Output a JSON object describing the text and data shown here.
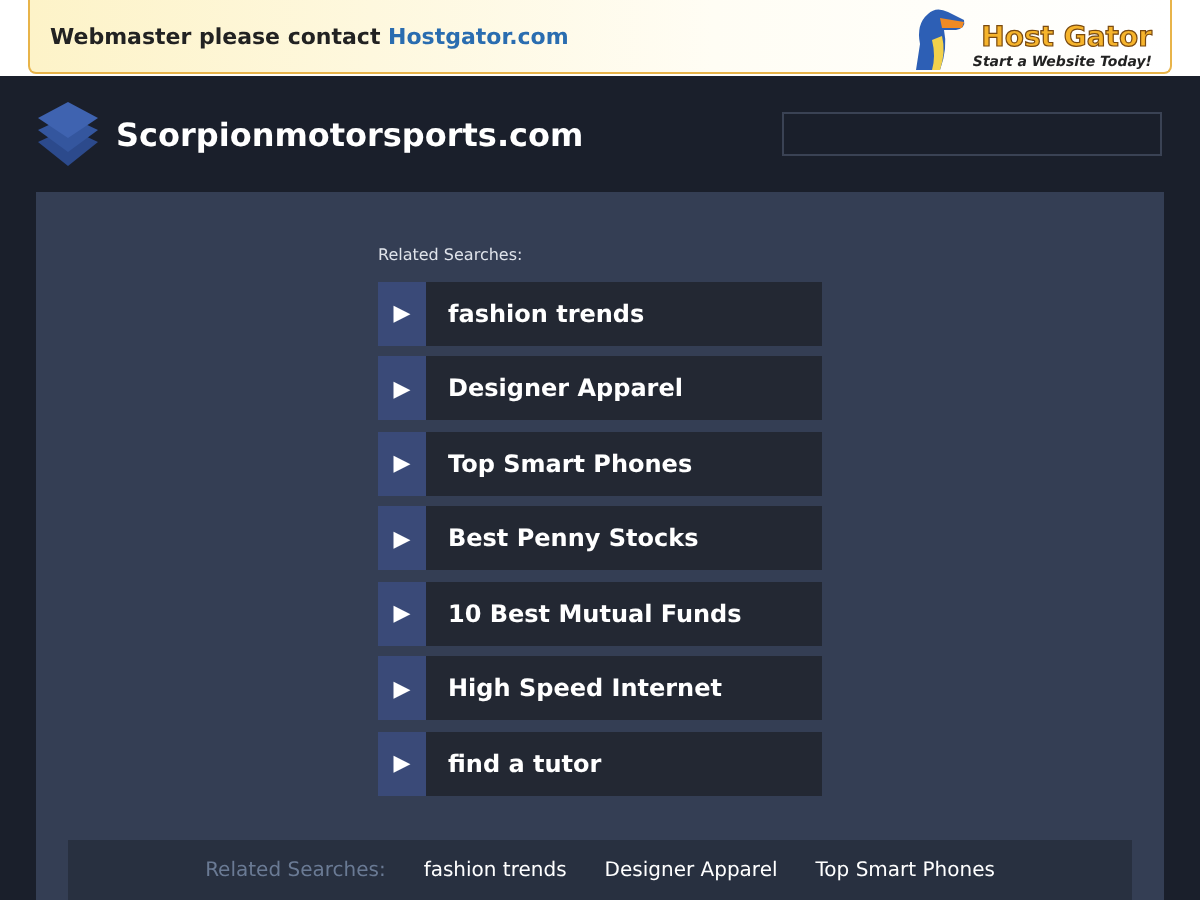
{
  "banner": {
    "message": "Webmaster please contact",
    "link": "Hostgator.com",
    "logo_name": "Host Gator",
    "logo_tagline": "Start a Website Today!"
  },
  "header": {
    "site_name": "Scorpionmotorsports.com"
  },
  "related": {
    "label": "Related Searches:",
    "items": [
      {
        "icon": "▶",
        "text": "fashion trends"
      },
      {
        "icon": "▶",
        "text": "Designer Apparel"
      },
      {
        "icon": "▶",
        "text": "Top Smart Phones"
      },
      {
        "icon": "▶",
        "text": "Best Penny Stocks"
      },
      {
        "icon": "▶",
        "text": "10 Best Mutual Funds"
      },
      {
        "icon": "▶",
        "text": "High Speed Internet"
      },
      {
        "icon": "▶",
        "text": "find a tutor"
      }
    ]
  },
  "footer": {
    "label": "Related Searches:",
    "links": [
      "fashion trends",
      "Designer Apparel",
      "Top Smart Phones"
    ]
  }
}
